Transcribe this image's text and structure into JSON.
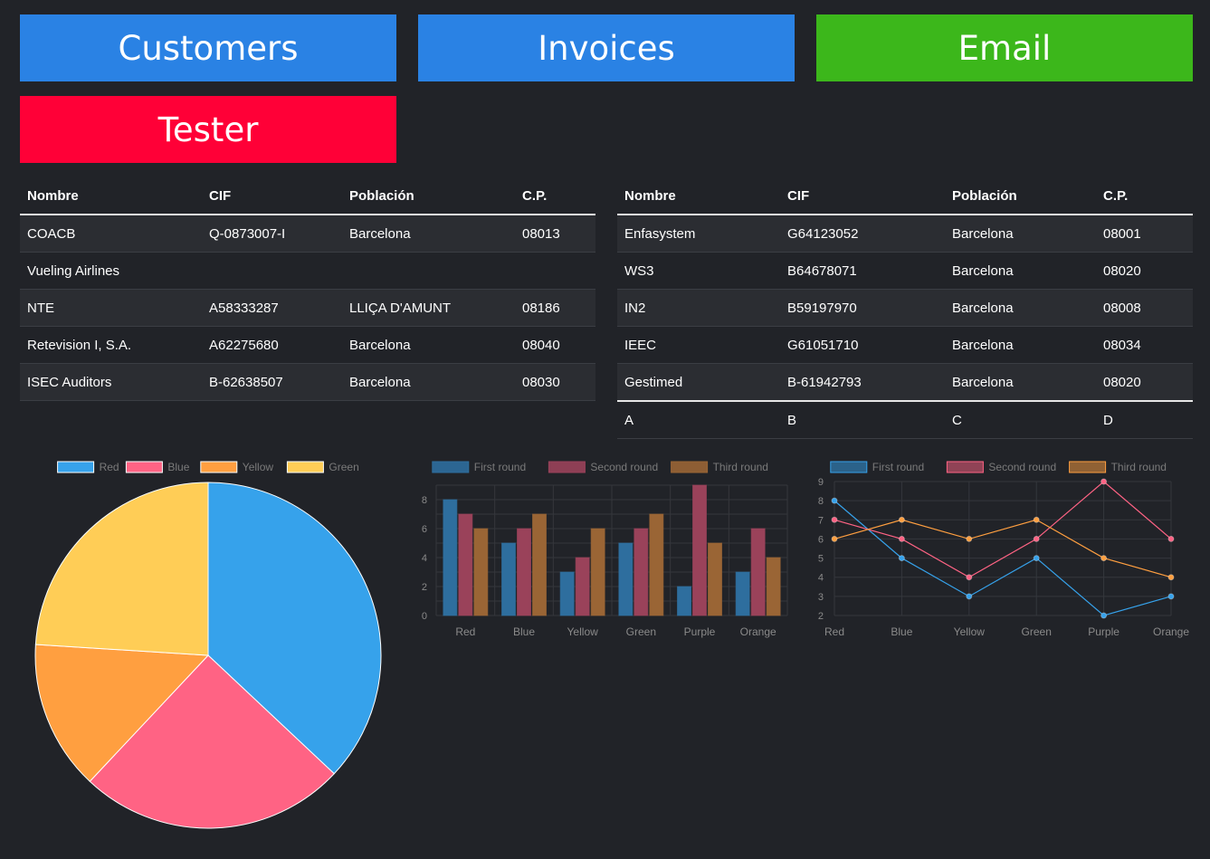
{
  "tiles": [
    {
      "label": "Customers",
      "color": "#2a82e4"
    },
    {
      "label": "Invoices",
      "color": "#2a82e4"
    },
    {
      "label": "Email",
      "color": "#3cb71b"
    },
    {
      "label": "Tester",
      "color": "#ff0037"
    }
  ],
  "table_left": {
    "headers": [
      "Nombre",
      "CIF",
      "Población",
      "C.P."
    ],
    "rows": [
      [
        "COACB",
        "Q-0873007-I",
        "Barcelona",
        "08013"
      ],
      [
        "Vueling Airlines",
        "",
        "",
        ""
      ],
      [
        "NTE",
        "A58333287",
        "LLIÇA D'AMUNT",
        "08186"
      ],
      [
        "Retevision I, S.A.",
        "A62275680",
        "Barcelona",
        "08040"
      ],
      [
        "ISEC Auditors",
        "B-62638507",
        "Barcelona",
        "08030"
      ]
    ]
  },
  "table_right": {
    "headers": [
      "Nombre",
      "CIF",
      "Población",
      "C.P."
    ],
    "rows": [
      [
        "Enfasystem",
        "G64123052",
        "Barcelona",
        "08001"
      ],
      [
        "WS3",
        "B64678071",
        "Barcelona",
        "08020"
      ],
      [
        "IN2",
        "B59197970",
        "Barcelona",
        "08008"
      ],
      [
        "IEEC",
        "G61051710",
        "Barcelona",
        "08034"
      ],
      [
        "Gestimed",
        "B-61942793",
        "Barcelona",
        "08020"
      ]
    ],
    "footer": [
      "A",
      "B",
      "C",
      "D"
    ]
  },
  "chart_data": [
    {
      "type": "pie",
      "legend": [
        "Red",
        "Blue",
        "Yellow",
        "Green"
      ],
      "values": [
        37,
        25,
        14,
        24
      ],
      "colors": [
        "#36a2eb",
        "#ff6384",
        "#ff9f40",
        "#ffcd56"
      ],
      "legend_position": "top"
    },
    {
      "type": "bar",
      "categories": [
        "Red",
        "Blue",
        "Yellow",
        "Green",
        "Purple",
        "Orange"
      ],
      "series": [
        {
          "name": "First round",
          "values": [
            8,
            5,
            3,
            5,
            2,
            3
          ],
          "color": "#2e6e9e"
        },
        {
          "name": "Second round",
          "values": [
            7,
            6,
            4,
            6,
            9,
            6
          ],
          "color": "#9a425a"
        },
        {
          "name": "Third round",
          "values": [
            6,
            7,
            6,
            7,
            5,
            4
          ],
          "color": "#9a6535"
        }
      ],
      "ylim": [
        0,
        9
      ],
      "yticks": [
        "0",
        "2",
        "4",
        "6",
        "8"
      ],
      "grid": true,
      "legend_position": "top"
    },
    {
      "type": "line",
      "categories": [
        "Red",
        "Blue",
        "Yellow",
        "Green",
        "Purple",
        "Orange"
      ],
      "series": [
        {
          "name": "First round",
          "values": [
            8,
            5,
            3,
            5,
            2,
            3
          ],
          "color": "#36a2eb"
        },
        {
          "name": "Second round",
          "values": [
            7,
            6,
            4,
            6,
            9,
            6
          ],
          "color": "#ff6384"
        },
        {
          "name": "Third round",
          "values": [
            6,
            7,
            6,
            7,
            5,
            4
          ],
          "color": "#ff9f40"
        }
      ],
      "ylim": [
        2,
        9
      ],
      "yticks": [
        "2",
        "3",
        "4",
        "5",
        "6",
        "7",
        "8",
        "9"
      ],
      "grid": true,
      "legend_position": "top"
    }
  ]
}
